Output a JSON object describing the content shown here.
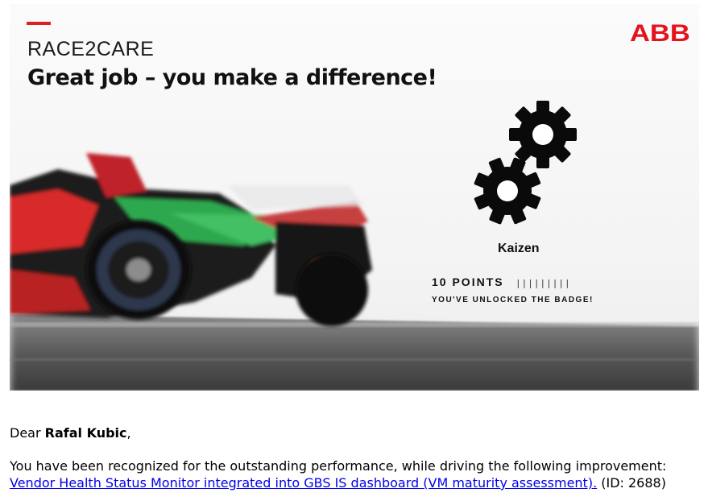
{
  "banner": {
    "program": "RACE2CARE",
    "headline": "Great job – you make a difference!",
    "logo_text": "ABB",
    "badge": {
      "name": "Kaizen",
      "points_label": "10 POINTS",
      "ticks": "|||||||||",
      "unlocked_text": "YOU'VE UNLOCKED THE BADGE!"
    },
    "icons": [
      "gear-icon",
      "gear-icon"
    ]
  },
  "message": {
    "greeting_prefix": "Dear ",
    "recipient_name": "Rafal Kubic",
    "greeting_suffix": ",",
    "body_text": "You have been recognized for the outstanding performance, while driving the following improvement:",
    "improvement_link": "Vendor Health Status Monitor integrated into GBS IS dashboard (VM maturity assessment).",
    "id_text": " (ID: 2688)"
  },
  "colors": {
    "accent_red": "#e02020",
    "abb_red": "#e4121b",
    "link_blue": "#0000ee",
    "car_green": "#2fa84f"
  }
}
